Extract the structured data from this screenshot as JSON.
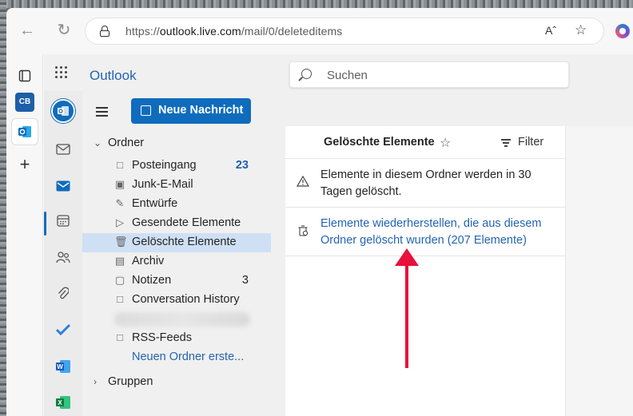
{
  "browser": {
    "url_prefix": "https://",
    "url_host": "outlook.live.com",
    "url_path": "/mail/0/deleteditems",
    "reader_icon": "Aˆ"
  },
  "app": {
    "name": "Outlook",
    "search_placeholder": "Suchen",
    "new_message_label": "Neue Nachricht"
  },
  "folders": {
    "section_label": "Ordner",
    "items": [
      {
        "label": "Posteingang",
        "count": "23",
        "icon": "inbox-icon"
      },
      {
        "label": "Junk-E-Mail",
        "count": "",
        "icon": "junk-icon"
      },
      {
        "label": "Entwürfe",
        "count": "",
        "icon": "draft-icon"
      },
      {
        "label": "Gesendete Elemente",
        "count": "",
        "icon": "sent-icon"
      },
      {
        "label": "Gelöschte Elemente",
        "count": "",
        "icon": "trash-icon",
        "selected": true
      },
      {
        "label": "Archiv",
        "count": "",
        "icon": "archive-icon"
      },
      {
        "label": "Notizen",
        "count": "3",
        "icon": "note-icon"
      },
      {
        "label": "Conversation History",
        "count": "",
        "icon": "folder-icon"
      },
      {
        "label": "RSS-Feeds",
        "count": "",
        "icon": "folder-icon"
      }
    ],
    "new_folder_link": "Neuen Ordner erste...",
    "groups_label": "Gruppen"
  },
  "message_list": {
    "title": "Gelöschte Elemente",
    "filter_label": "Filter",
    "info_text": "Elemente in diesem Ordner werden in 30 Tagen gelöscht.",
    "recover_link": "Elemente wiederherstellen, die aus diesem Ordner gelöscht wurden (207 Elemente)"
  },
  "colors": {
    "accent": "#0f6cbd",
    "link": "#2464b4",
    "selected_bg": "#cfe0f5",
    "annotation_arrow": "#e8103c"
  }
}
